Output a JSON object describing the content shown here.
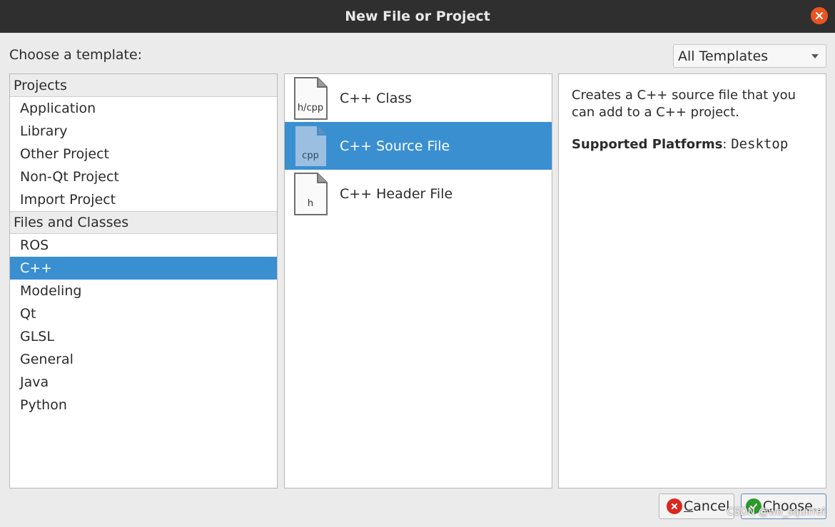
{
  "window": {
    "title": "New File or Project",
    "close_icon": "close-icon",
    "accent_close": "#e95420"
  },
  "header": {
    "choose_label": "Choose a template:",
    "template_filter": "All Templates"
  },
  "categories": {
    "groups": [
      {
        "header": "Projects",
        "items": [
          "Application",
          "Library",
          "Other Project",
          "Non-Qt Project",
          "Import Project"
        ]
      },
      {
        "header": "Files and Classes",
        "items": [
          "ROS",
          "C++",
          "Modeling",
          "Qt",
          "GLSL",
          "General",
          "Java",
          "Python"
        ]
      }
    ],
    "selected": "C++"
  },
  "templates": {
    "items": [
      {
        "icon_text": "h/cpp",
        "label": "C++ Class",
        "icon": "file-icon"
      },
      {
        "icon_text": "cpp",
        "label": "C++ Source File",
        "icon": "file-icon"
      },
      {
        "icon_text": "h",
        "label": "C++ Header File",
        "icon": "file-icon"
      }
    ],
    "selected": "C++ Source File"
  },
  "description": {
    "text": "Creates a C++ source file that you can add to a C++ project.",
    "platforms_label": "Supported Platforms",
    "platforms_sep": ":",
    "platforms_value": "Desktop"
  },
  "buttons": {
    "cancel_first": "C",
    "cancel_rest": "ancel",
    "choose_first": "C",
    "choose_rest": "hoose...",
    "cancel_icon": "cancel-icon",
    "choose_icon": "check-icon"
  },
  "watermark": "CSDN @wo_squirrel",
  "colors": {
    "selection": "#3a8fd1",
    "titlebar": "#2f2f2f"
  }
}
